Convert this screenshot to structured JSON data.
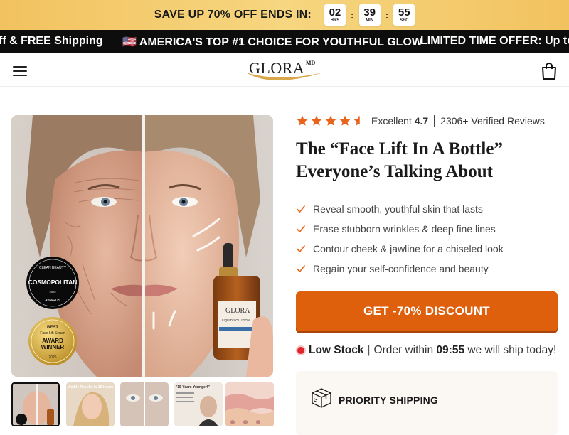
{
  "promo": {
    "text": "SAVE UP 70% OFF ENDS IN:",
    "timer": [
      {
        "value": "02",
        "unit": "HRS"
      },
      {
        "value": "39",
        "unit": "MIN"
      },
      {
        "value": "55",
        "unit": "SEC"
      }
    ]
  },
  "marquee": {
    "items": [
      "ff & FREE Shipping",
      "🇺🇸 AMERICA'S TOP #1 CHOICE FOR YOUTHFUL GLOW",
      "LIMITED TIME OFFER: Up to"
    ]
  },
  "header": {
    "logo_text": "GLORA",
    "logo_sup": "MD",
    "menu_icon": "hamburger-menu-icon",
    "cart_icon": "shopping-bag-icon"
  },
  "gallery": {
    "badges": {
      "cosmo_top": "CLEAN BEAUTY",
      "cosmo_name": "COSMOPOLITAN",
      "cosmo_year": "2025",
      "cosmo_bottom": "AWARDS",
      "award_best": "BEST",
      "award_cat": "Face Lift Serum",
      "award_title": "AWARD",
      "award_title2": "WINNER",
      "award_year": "2025"
    },
    "bottle_brand": "GLORA",
    "bottle_line1": "LIQUID SOLUTION",
    "thumb_captions": [
      "Visible Results in 15 Hours",
      "\"15 Years Younger!\""
    ]
  },
  "rating": {
    "stars": 4.7,
    "label": "Excellent",
    "score": "4.7",
    "reviews": "2306+ Verified Reviews"
  },
  "title": {
    "line1": "The “Face Lift In A Bottle”",
    "line2": "Everyone’s Talking About"
  },
  "benefits": [
    "Reveal smooth, youthful skin that lasts",
    "Erase stubborn wrinkles & deep fine lines",
    "Contour cheek & jawline for a chiseled look",
    "Regain your self-confidence and beauty"
  ],
  "cta": {
    "label": "GET -70% DISCOUNT"
  },
  "stock": {
    "status": "Low Stock",
    "prefix": "Order within",
    "time": "09:55",
    "suffix": "we will ship today!"
  },
  "shipping": {
    "label": "PRIORITY SHIPPING"
  },
  "colors": {
    "promo_bg": "#f4c96b",
    "accent": "#de5f0c",
    "star": "#e9631a",
    "check": "#e9631a",
    "stock_dot": "#e0242b"
  }
}
